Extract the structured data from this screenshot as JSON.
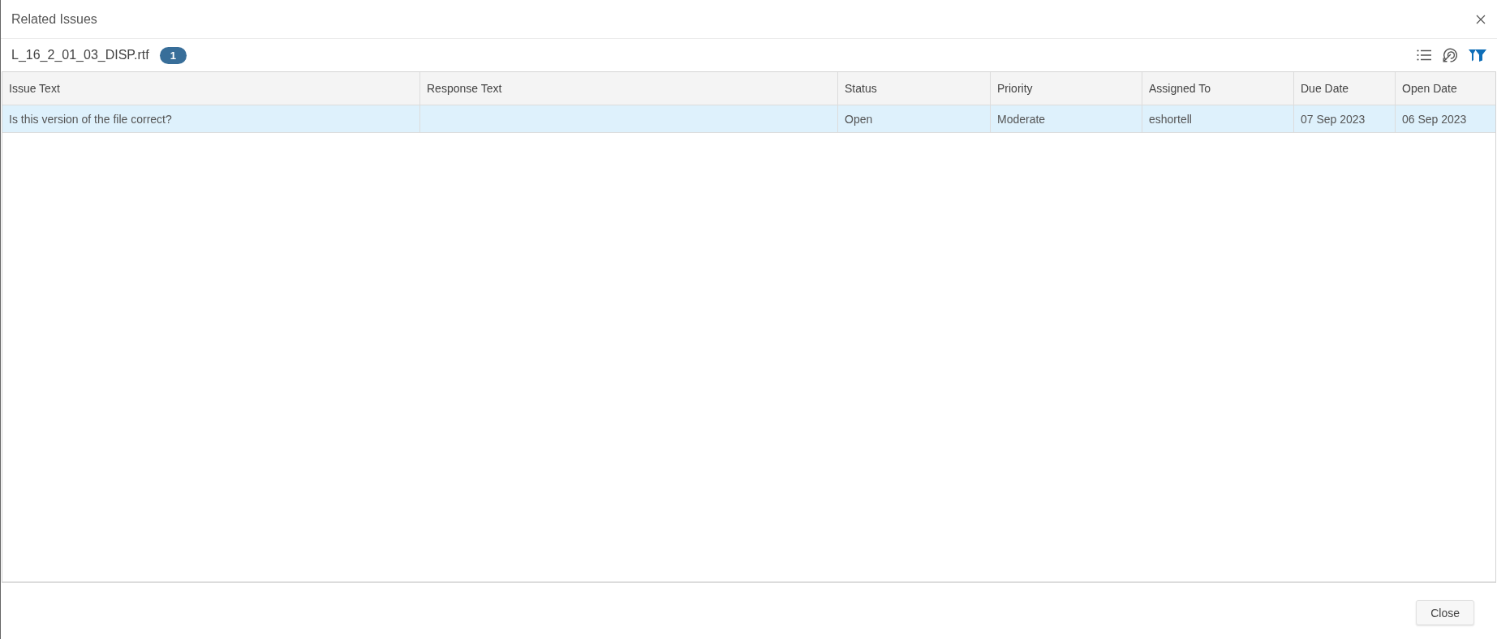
{
  "window": {
    "title": "Related Issues"
  },
  "file": {
    "name": "L_16_2_01_03_DISP.rtf",
    "count": "1"
  },
  "toolbar": [
    {
      "kind": "list",
      "active": false
    },
    {
      "kind": "target",
      "active": false
    },
    {
      "kind": "filter",
      "active": true
    }
  ],
  "table": {
    "columns": [
      "Issue Text",
      "Response Text",
      "Status",
      "Priority",
      "Assigned To",
      "Due Date",
      "Open Date"
    ],
    "rows": [
      {
        "selected": true,
        "cells": [
          "Is this version of the file correct?",
          null,
          "Open",
          "Moderate",
          "eshortell",
          "07 Sep 2023",
          "06 Sep 2023"
        ]
      }
    ]
  },
  "footer": {
    "close_button": "Close"
  }
}
